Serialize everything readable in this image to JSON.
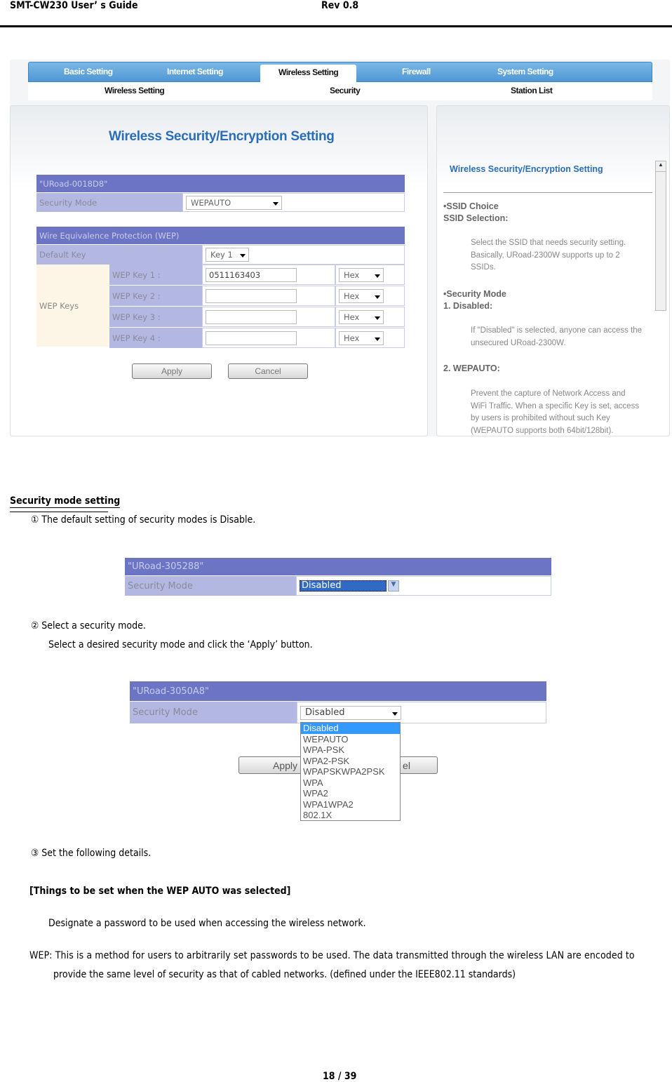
{
  "header": {
    "title": "SMT-CW230 User’ s Guide",
    "rev": "Rev 0.8"
  },
  "screenshot1": {
    "tabs": [
      "Basic Setting",
      "Internet Setting",
      "Wireless Setting",
      "Firewall",
      "System Setting"
    ],
    "active_tab": "Wireless Setting",
    "subtabs": [
      "Wireless Setting",
      "Security",
      "Station List"
    ],
    "title": "Wireless Security/Encryption Setting",
    "ssid": "\"URoad-0018D8\"",
    "security_mode_label": "Security Mode",
    "security_mode_value": "WEPAUTO",
    "wep_header": "Wire Equivalence Protection (WEP)",
    "default_key_label": "Default Key",
    "default_key_value": "Key 1",
    "wep_keys_label": "WEP Keys",
    "keys": [
      {
        "label": "WEP Key 1 :",
        "value": "0511163403",
        "format": "Hex"
      },
      {
        "label": "WEP Key 2 :",
        "value": "",
        "format": "Hex"
      },
      {
        "label": "WEP Key 3 :",
        "value": "",
        "format": "Hex"
      },
      {
        "label": "WEP Key 4 :",
        "value": "",
        "format": "Hex"
      }
    ],
    "apply": "Apply",
    "cancel": "Cancel",
    "help": {
      "title": "Wireless Security/Encryption Setting",
      "ssid_choice": "•SSID Choice",
      "ssid_selection": "SSID Selection:",
      "ssid_text": [
        "Select the SSID that needs security setting.",
        "Basically, URoad-2300W supports up to 2",
        "SSIDs."
      ],
      "security_mode": "•Security Mode",
      "disabled_head": "1. Disabled:",
      "disabled_text": [
        "If \"Disabled\" is selected, anyone can access the",
        "unsecured URoad-2300W."
      ],
      "wepauto_head": "2. WEPAUTO:",
      "wepauto_text": [
        "Prevent the capture of Network Access and",
        "WiFi Traffic. When a specific Key is set, access",
        "by users is prohibited without such Key",
        "(WEPAUTO supports both 64bit/128bit)."
      ]
    }
  },
  "section": {
    "heading": "Security mode setting",
    "step1": "①  The default setting of security modes is Disable.",
    "step2": "②  Select a security mode.",
    "step2b": "Select a desired security mode and click the  ‘Apply’  button.",
    "step3": "③  Set the following details.",
    "wep_heading": "[Things to be set when the WEP AUTO was selected]",
    "designate": "Designate a password to be used when accessing the wireless network.",
    "wep_line1": "WEP: This is a method for users to arbitrarily set passwords to be used. The data transmitted through the wireless LAN are encoded to",
    "wep_line2": "provide the same level of security as that of cabled networks. (defined under the IEEE802.11 standards)"
  },
  "screenshot2": {
    "ssid": "\"URoad-305288\"",
    "label": "Security Mode",
    "value": "Disabled"
  },
  "screenshot3": {
    "ssid": "\"URoad-3050A8\"",
    "label": "Security Mode",
    "value": "Disabled",
    "apply": "Apply",
    "cancel_visible": "el",
    "options": [
      "Disabled",
      "WEPAUTO",
      "WPA-PSK",
      "WPA2-PSK",
      "WPAPSKWPA2PSK",
      "WPA",
      "WPA2",
      "WPA1WPA2",
      "802.1X"
    ]
  },
  "footer": {
    "page": "18 / 39"
  }
}
